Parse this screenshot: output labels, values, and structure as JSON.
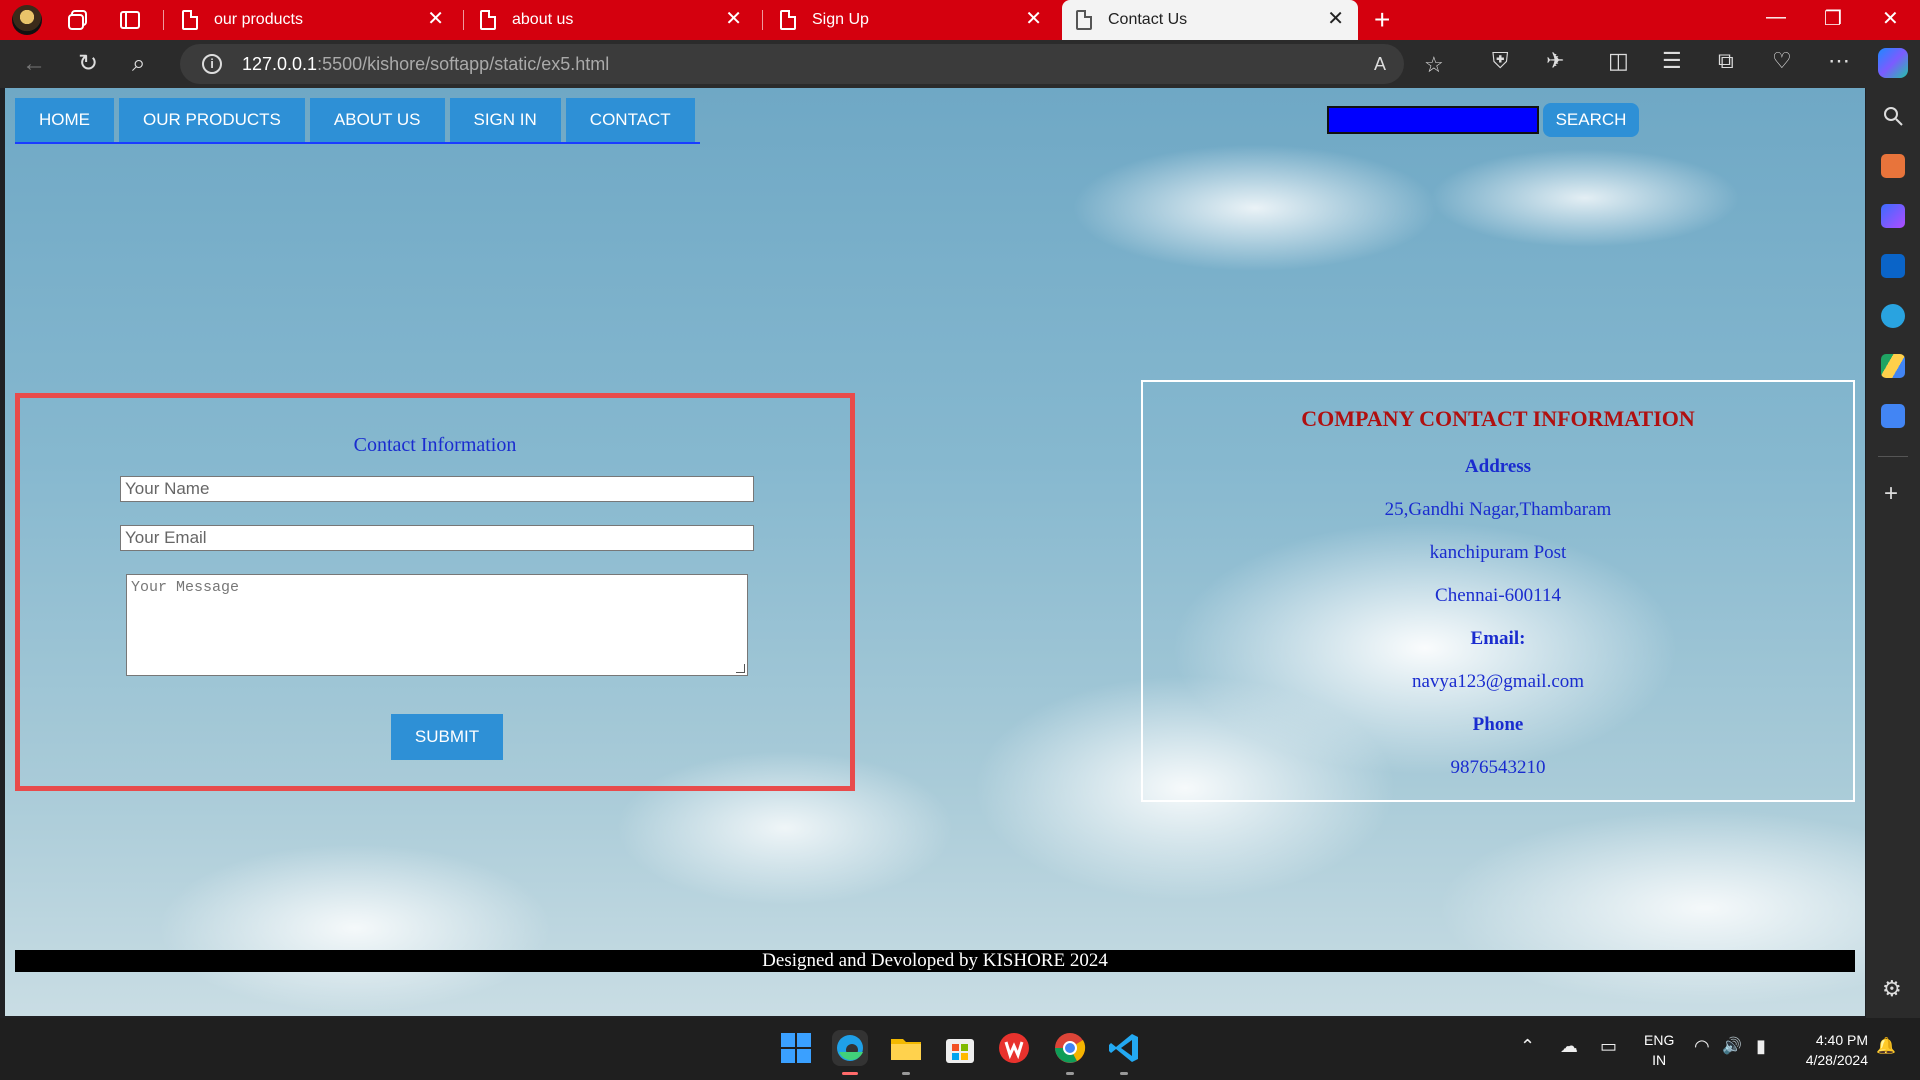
{
  "browser": {
    "tabs": [
      {
        "title": "our products"
      },
      {
        "title": "about us"
      },
      {
        "title": "Sign Up"
      },
      {
        "title": "Contact Us",
        "active": true
      }
    ],
    "url_host": "127.0.0.1",
    "url_path": ":5500/kishore/softapp/static/ex5.html",
    "icons": {
      "tab_close": "✕",
      "new_tab": "+",
      "minimize": "—",
      "restore": "❐",
      "close_window": "✕",
      "back": "←",
      "refresh": "↻",
      "search": "⌕",
      "info": "i",
      "read_aloud": "A",
      "favorite": "☆",
      "shield": "⛨",
      "extensions": "✈",
      "split": "◫",
      "favorites": "☰",
      "collections": "⧉",
      "health": "♡",
      "more": "⋯",
      "sidebar_add": "+",
      "sidebar_settings": "⚙"
    }
  },
  "nav": {
    "items": [
      "HOME",
      "OUR PRODUCTS",
      "ABOUT US",
      "SIGN IN",
      "CONTACT"
    ],
    "search_button": "SEARCH"
  },
  "form": {
    "title": "Contact Information",
    "name_placeholder": "Your Name",
    "email_placeholder": "Your Email",
    "message_placeholder": "Your Message",
    "submit": "SUBMIT"
  },
  "company": {
    "title": "COMPANY CONTACT INFORMATION",
    "address_label": "Address",
    "address_lines": [
      "25,Gandhi Nagar,Thambaram",
      "kanchipuram Post",
      "Chennai-600114"
    ],
    "email_label": "Email:",
    "email": "navya123@gmail.com",
    "phone_label": "Phone",
    "phone": "9876543210"
  },
  "footer": {
    "text": "Designed and Devoloped by KISHORE 2024"
  },
  "taskbar": {
    "lang_line1": "ENG",
    "lang_line2": "IN",
    "time": "4:40 PM",
    "date": "4/28/2024",
    "icons": {
      "tray_chevron": "⌃",
      "cloud": "☁",
      "keyboard": "▭",
      "wifi": "◠",
      "volume": "🔊",
      "battery": "▮",
      "notifications": "🔔"
    }
  },
  "colors": {
    "titlebar": "#d4000e",
    "button_blue": "#2e90d6",
    "form_border": "#e84b4b",
    "heading_red": "#b01010",
    "text_blue": "#1a2ccf",
    "search_input": "#0000ff"
  }
}
